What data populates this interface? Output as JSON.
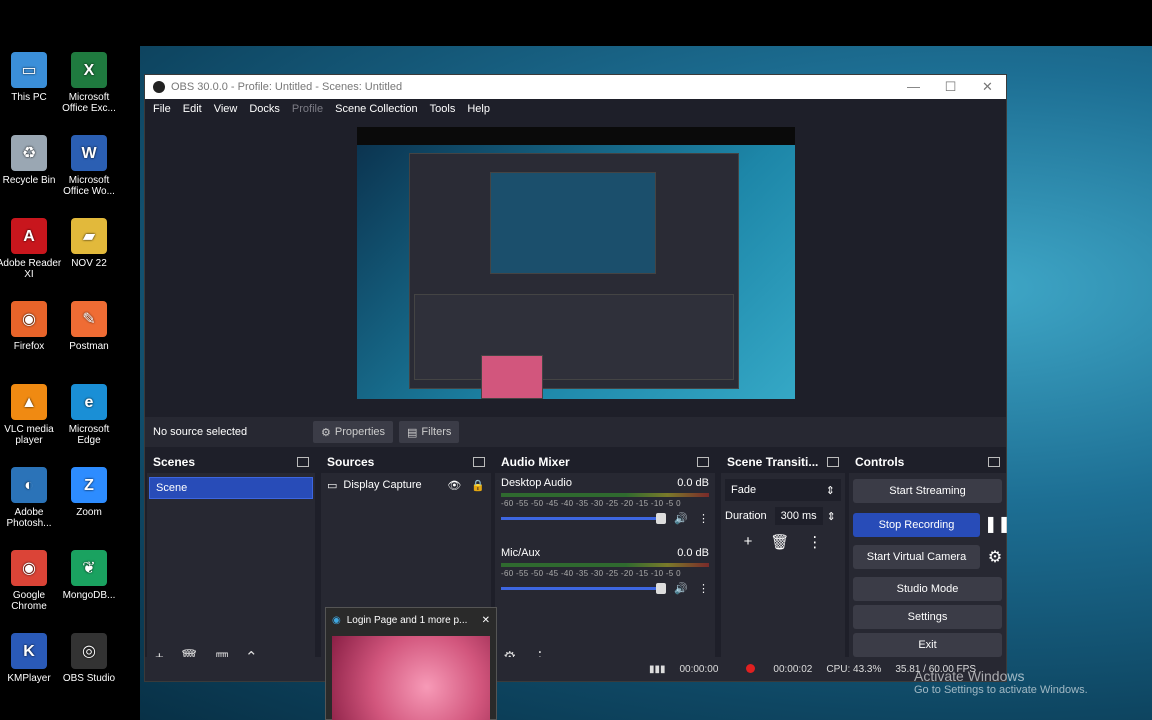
{
  "desktop_icons": [
    {
      "label": "This PC",
      "icon": "monitor-icon"
    },
    {
      "label": "Microsoft Office Exc...",
      "icon": "excel-icon"
    },
    {
      "label": "Recycle Bin",
      "icon": "recycle-bin-icon"
    },
    {
      "label": "Microsoft Office Wo...",
      "icon": "word-icon"
    },
    {
      "label": "Adobe Reader XI",
      "icon": "adobe-reader-icon"
    },
    {
      "label": "NOV 22",
      "icon": "folder-icon"
    },
    {
      "label": "Firefox",
      "icon": "firefox-icon"
    },
    {
      "label": "Postman",
      "icon": "postman-icon"
    },
    {
      "label": "VLC media player",
      "icon": "vlc-icon"
    },
    {
      "label": "Microsoft Edge",
      "icon": "edge-icon"
    },
    {
      "label": "Adobe Photosh...",
      "icon": "photoshop-icon"
    },
    {
      "label": "Zoom",
      "icon": "zoom-icon"
    },
    {
      "label": "Google Chrome",
      "icon": "chrome-icon"
    },
    {
      "label": "MongoDB...",
      "icon": "mongodb-icon"
    },
    {
      "label": "KMPlayer",
      "icon": "kmplayer-icon"
    },
    {
      "label": "OBS Studio",
      "icon": "obs-icon"
    }
  ],
  "window": {
    "title": "OBS 30.0.0 - Profile: Untitled - Scenes: Untitled",
    "controls": {
      "minimize": "—",
      "maximize": "☐",
      "close": "✕"
    }
  },
  "menu": [
    "File",
    "Edit",
    "View",
    "Docks",
    "Profile",
    "Scene Collection",
    "Tools",
    "Help"
  ],
  "source_bar": {
    "no_source": "No source selected",
    "properties": "Properties",
    "filters": "Filters"
  },
  "scenes": {
    "title": "Scenes",
    "items": [
      "Scene"
    ]
  },
  "sources": {
    "title": "Sources",
    "items": [
      "Display Capture"
    ]
  },
  "audio": {
    "title": "Audio Mixer",
    "channels": [
      {
        "name": "Desktop Audio",
        "db": "0.0 dB"
      },
      {
        "name": "Mic/Aux",
        "db": "0.0 dB"
      }
    ],
    "ticks": "-60 -55 -50 -45 -40 -35 -30 -25 -20 -15 -10 -5 0"
  },
  "transitions": {
    "title": "Scene Transiti...",
    "type": "Fade",
    "duration_label": "Duration",
    "duration_value": "300 ms"
  },
  "controls": {
    "title": "Controls",
    "start_streaming": "Start Streaming",
    "stop_recording": "Stop Recording",
    "start_virtual_camera": "Start Virtual Camera",
    "studio_mode": "Studio Mode",
    "settings": "Settings",
    "exit": "Exit"
  },
  "status": {
    "stream_time": "00:00:00",
    "rec_time": "00:00:02",
    "cpu": "CPU: 43.3%",
    "fps": "35.81 / 60.00 FPS"
  },
  "taskbar_thumb": {
    "title": "Login Page and 1 more p...",
    "close": "✕"
  },
  "watermark": {
    "title": "Activate Windows",
    "subtitle": "Go to Settings to activate Windows."
  },
  "colors": {
    "accent": "#284cb8",
    "recording": "#e02020",
    "panel": "#272832",
    "bg": "#1e1f29"
  }
}
